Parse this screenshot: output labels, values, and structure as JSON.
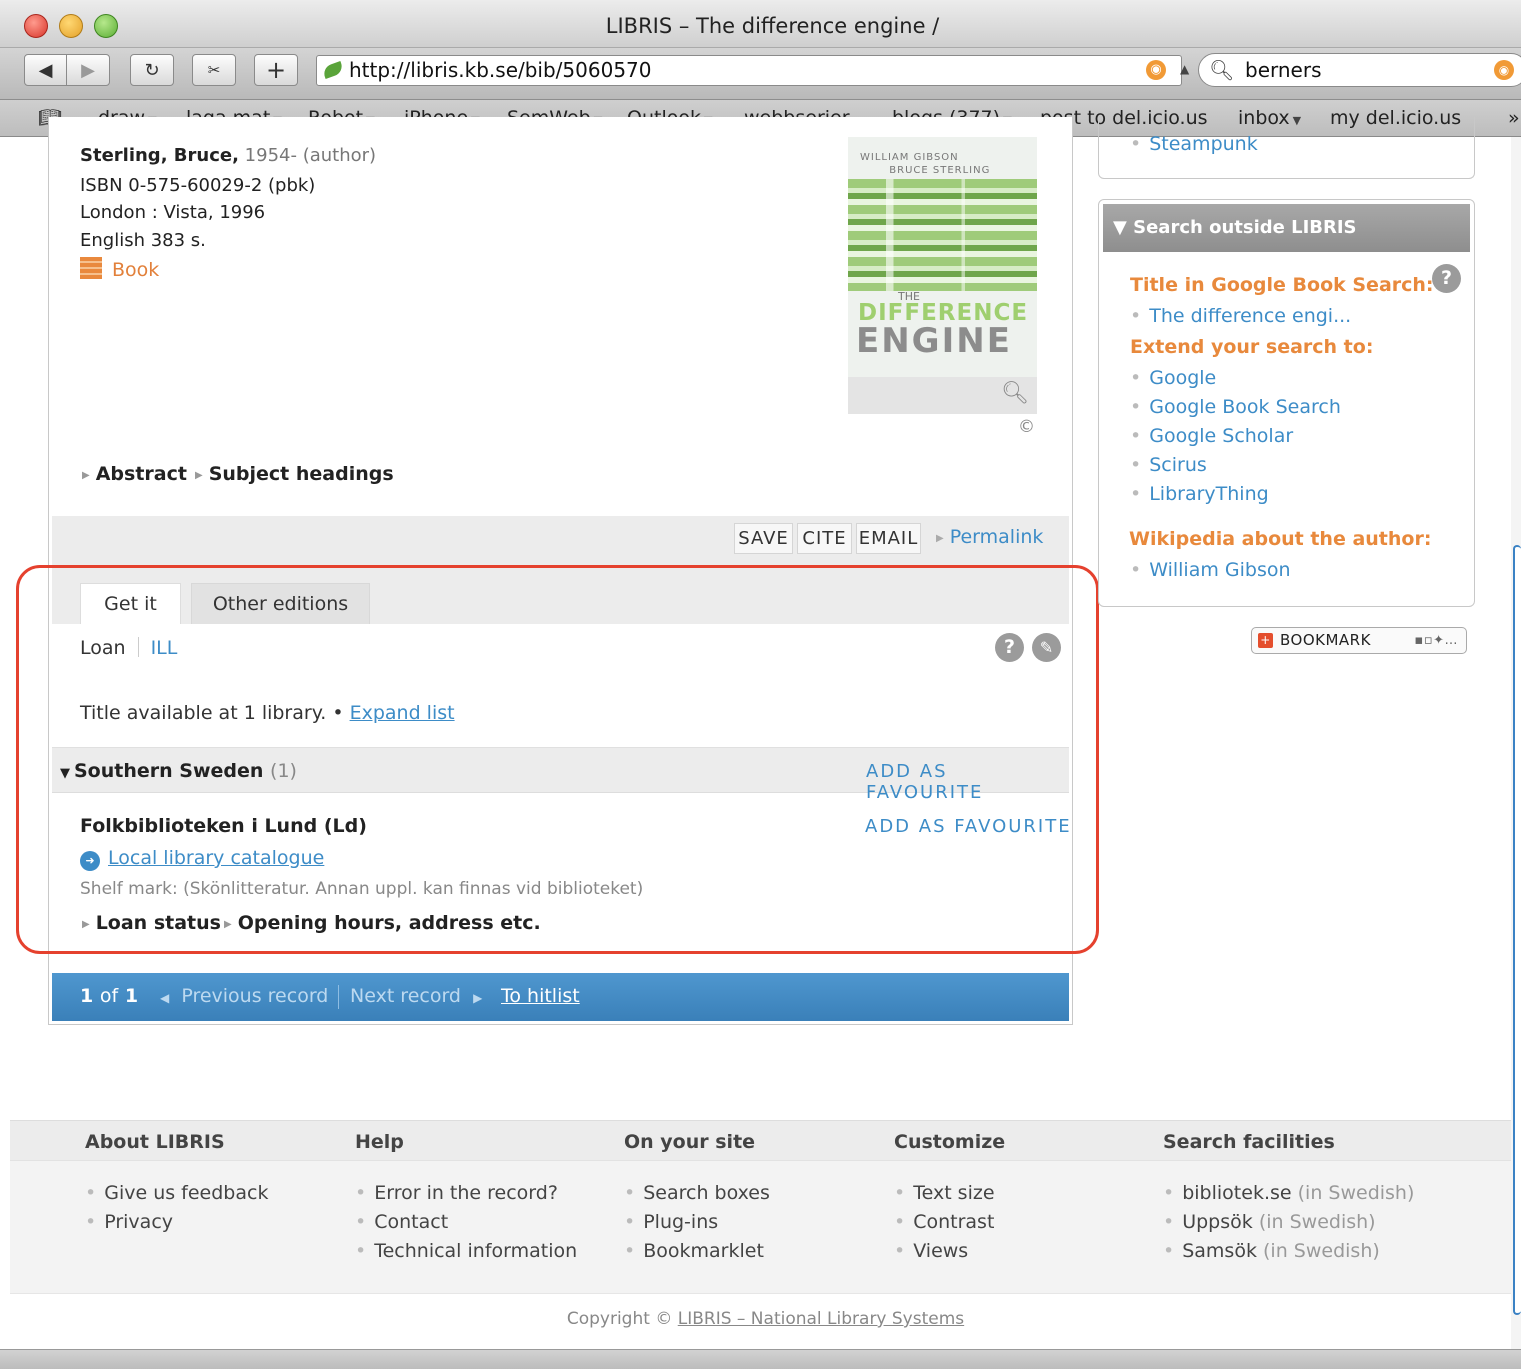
{
  "window": {
    "title": "LIBRIS – The difference engine /"
  },
  "toolbar": {
    "url": "http://libris.kb.se/bib/5060570",
    "search_value": "berners",
    "back_icon": "◀",
    "forward_icon": "▶",
    "reload_icon": "↻",
    "add_icon": "+"
  },
  "bookmarks": [
    "draw",
    "laga mat",
    "Robot",
    "iPhone",
    "SemWeb",
    "Outlook",
    "webbserier",
    "blogs (377)",
    "post to del.icio.us",
    "inbox",
    "my del.icio.us"
  ],
  "record": {
    "author_name": "Sterling, Bruce,",
    "author_meta": "1954- (author)",
    "isbn": "ISBN 0-575-60029-2 (pbk)",
    "publisher": "London : Vista, 1996",
    "language_pages": "English 383 s.",
    "type": "Book",
    "cover": {
      "authors_line1": "WILLIAM GIBSON",
      "authors_line2": "BRUCE STERLING",
      "title_the": "THE",
      "title_1": "DIFFERENCE",
      "title_2": "ENGINE",
      "copyright_mark": "©"
    },
    "toggles": {
      "abstract": "Abstract",
      "subjects": "Subject headings"
    }
  },
  "actions": {
    "save": "SAVE",
    "cite": "CITE",
    "email": "EMAIL",
    "permalink": "Permalink"
  },
  "tabs": {
    "get_it": "Get it",
    "other_editions": "Other editions"
  },
  "getit": {
    "loan": "Loan",
    "ill": "ILL",
    "availability_text": "Title available at 1 library. •",
    "expand_list": "Expand list",
    "region": {
      "name": "Southern Sweden",
      "count": "(1)",
      "fav": "ADD AS FAVOURITE"
    },
    "library": {
      "name": "Folkbiblioteken i Lund (Ld)",
      "fav": "ADD AS FAVOURITE",
      "local_catalogue": "Local library catalogue",
      "shelf": "Shelf mark: (Skönlitteratur. Annan uppl. kan finnas vid biblioteket)",
      "loan_status": "Loan status",
      "opening_hours": "Opening hours, address etc."
    }
  },
  "pager": {
    "current": "1",
    "of_label": "of",
    "total": "1",
    "prev": "Previous record",
    "next": "Next record",
    "hitlist": "To hitlist"
  },
  "sidebar": {
    "steampunk": "Steampunk",
    "outside_heading": "Search outside LIBRIS",
    "google_book_heading": "Title in Google Book Search:",
    "google_book_link": "The difference engi...",
    "extend_heading": "Extend your search to:",
    "extend_links": [
      "Google",
      "Google Book Search",
      "Google Scholar",
      "Scirus",
      "LibraryThing"
    ],
    "wikipedia_heading": "Wikipedia about the author:",
    "wikipedia_link": "William Gibson",
    "bookmark_button": "BOOKMARK"
  },
  "footer": {
    "columns": [
      {
        "heading": "About LIBRIS",
        "links": [
          [
            "Give us feedback",
            ""
          ],
          [
            "Privacy",
            ""
          ]
        ]
      },
      {
        "heading": "Help",
        "links": [
          [
            "Error in the record?",
            ""
          ],
          [
            "Contact",
            ""
          ],
          [
            "Technical information",
            ""
          ]
        ]
      },
      {
        "heading": "On your site",
        "links": [
          [
            "Search boxes",
            ""
          ],
          [
            "Plug-ins",
            ""
          ],
          [
            "Bookmarklet",
            ""
          ]
        ]
      },
      {
        "heading": "Customize",
        "links": [
          [
            "Text size",
            ""
          ],
          [
            "Contrast",
            ""
          ],
          [
            "Views",
            ""
          ]
        ]
      },
      {
        "heading": "Search facilities",
        "links": [
          [
            "bibliotek.se",
            "(in Swedish)"
          ],
          [
            "Uppsök",
            "(in Swedish)"
          ],
          [
            "Samsök",
            "(in Swedish)"
          ]
        ]
      }
    ],
    "copyright_prefix": "Copyright ©",
    "copyright_link": "LIBRIS – National Library Systems"
  },
  "colors": {
    "link": "#3d8cc7",
    "accent_orange": "#e8893c",
    "pager_blue": "#3a80b9",
    "highlight_red": "#e5412e"
  }
}
